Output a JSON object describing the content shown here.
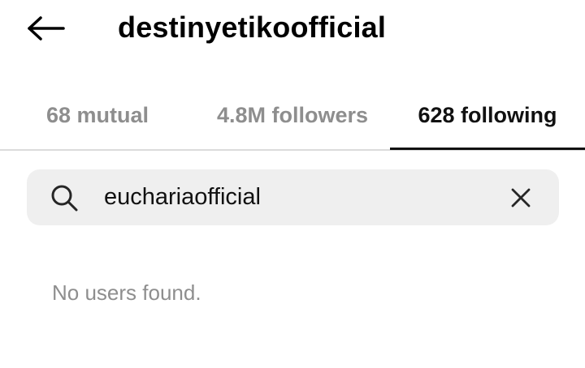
{
  "header": {
    "title": "destinyetikoofficial",
    "back_icon": "arrow-left-icon"
  },
  "tabs": [
    {
      "label": "68 mutual",
      "active": false
    },
    {
      "label": "4.8M followers",
      "active": false
    },
    {
      "label": "628 following",
      "active": true
    }
  ],
  "search": {
    "value": "euchariaofficial",
    "search_icon": "search-icon",
    "clear_icon": "close-icon"
  },
  "results": {
    "empty_message": "No users found."
  },
  "colors": {
    "active_tab": "#111111",
    "inactive_tab": "#8e8e8e",
    "search_background": "#efefef",
    "divider": "#dbdbdb"
  }
}
